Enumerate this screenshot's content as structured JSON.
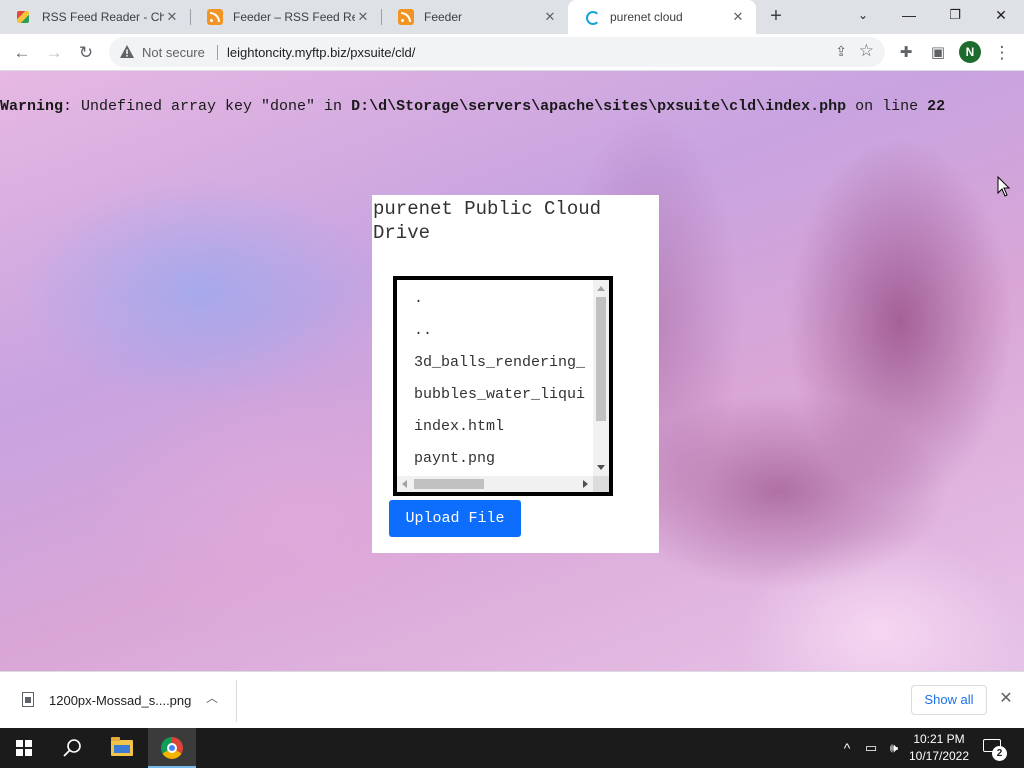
{
  "browser": {
    "tabs": [
      {
        "title": "RSS Feed Reader - Chrome",
        "favicon": "rss-reader-icon",
        "active": false
      },
      {
        "title": "Feeder – RSS Feed Reader",
        "favicon": "rss-icon",
        "active": false
      },
      {
        "title": "Feeder",
        "favicon": "rss-icon",
        "active": false
      },
      {
        "title": "purenet cloud",
        "favicon": "loading-icon",
        "active": true
      }
    ],
    "new_tab_label": "+",
    "close_glyph": "✕"
  },
  "toolbar": {
    "security_label": "Not secure",
    "url": "leightoncity.myftp.biz/pxsuite/cld/",
    "profile_initial": "N"
  },
  "page": {
    "warning": {
      "label": "Warning",
      "message_pre": ": Undefined array key \"done\" in ",
      "file_path": "D:\\d\\Storage\\servers\\apache\\sites\\pxsuite\\cld\\index.php",
      "message_mid": " on line ",
      "line_number": "22"
    },
    "card": {
      "title": "purenet Public Cloud Drive",
      "files": [
        ".",
        "..",
        "3d_balls_rendering_",
        "bubbles_water_liqui",
        "index.html",
        "paynt.png"
      ],
      "upload_label": "Upload File"
    },
    "colors": {
      "upload_button": "#0d6efd",
      "filebox_border": "#000000"
    }
  },
  "downloads": {
    "file_name": "1200px-Mossad_s....png",
    "show_all_label": "Show all"
  },
  "taskbar": {
    "time": "10:21 PM",
    "date": "10/17/2022",
    "notification_count": "2"
  }
}
